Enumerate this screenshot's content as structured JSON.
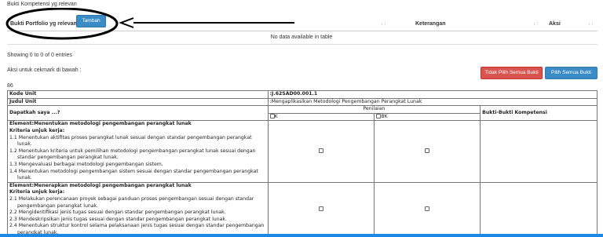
{
  "section_label": "Bukti Kompetensi yg relevan",
  "table_header": {
    "col1": "Bukti Portfolio yg relevan",
    "col2": "Keterangan",
    "col3": "Aksi",
    "sort_glyph": "↓↑"
  },
  "add_button": "Tambah",
  "no_data": "No data available in table",
  "entries_info": "Showing 0 to 0 of 0 entries",
  "action_hint": "Aksi untuk cekmark di bawah :",
  "btn_uncheck_all": "Tidak Pilih Semua Bukti",
  "btn_check_all": "Pilih Semua Bukti",
  "count": "86",
  "kompetensi": {
    "kode_label": "Kode Unit",
    "kode_value": ":J.62SAD00.001.1",
    "judul_label": "Judul Unit",
    "judul_value": ":Mengaplikasikan Metodologi Pengembangan Perangkat Lunak",
    "question": "Dapatkah saya ...?",
    "penilaian": "Penilaian",
    "opt_k": "K",
    "opt_bk": "BK",
    "bukti_col": "Bukti-Bukti Kompetensi",
    "elements": [
      {
        "title": "Element:Menentukan metodologi pengembangan perangkat lunak",
        "kriteria": "Kriteria unjuk kerja:",
        "items": [
          "1.1 Menentukan aktifitas proses perangkat lunak sesuai dengan standar pengembangan perangkat lunak.",
          "1.2 Menentukan kriteria untuk pemilihan metodologi pengembangan perangkat lunak sesuai dengan standar pengembangan perangkat lunak.",
          "1.3 Mengevaluasi berbagai metodologi pengembangan sistem.",
          "1.4 Menentukan metodologi pengembangan sistem sesuai dengan standar pengembangan perangkat lunak."
        ]
      },
      {
        "title": "Element:Menerapkan metodologi pengembangan perangkat lunak",
        "kriteria": "Kriteria unjuk kerja:",
        "items": [
          "2.1 Melakukan perencanaan proyek sebagai panduan proses pengembangan sesuai dengan standar pengembangan perangkat lunak.",
          "2.2 Mengidentifikasi jenis tugas sesuai dengan standar pengembangan perangkat lunak.",
          "2.3 Mendeskripsikan jenis tugas sesuai dengan standar pengembangan perangkat lunak.",
          "2.4 Menentukan struktur kontrol selama pelaksanaan jenis tugas sesuai dengan standar pengembangan perangkat lunak."
        ]
      }
    ]
  }
}
